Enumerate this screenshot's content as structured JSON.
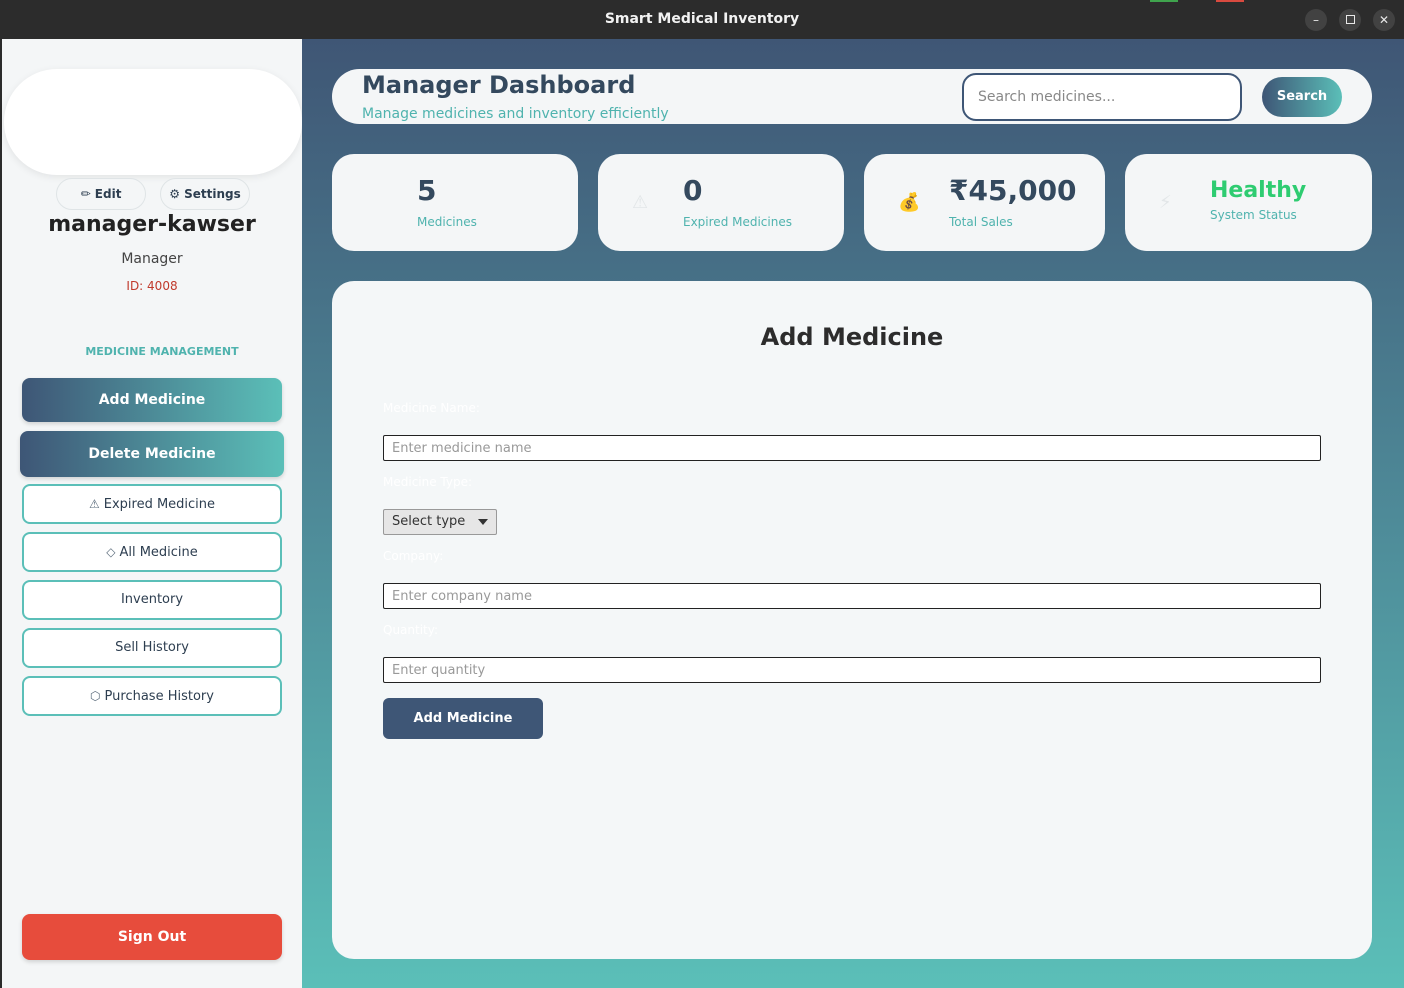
{
  "window": {
    "title": "Smart Medical Inventory",
    "controls": {
      "minimize": "–",
      "close": "✕"
    }
  },
  "sidebar": {
    "edit_label": "✏ Edit",
    "settings_label": "⚙ Settings",
    "username": "manager-kawser",
    "role": "Manager",
    "user_id": "ID: 4008",
    "section_title": "MEDICINE MANAGEMENT",
    "nav": {
      "add_medicine": "Add Medicine",
      "delete_medicine": "Delete Medicine",
      "expired": {
        "icon": "⚠",
        "label": "Expired Medicine"
      },
      "all": {
        "icon": "◇",
        "label": "All Medicine"
      },
      "inventory": {
        "label": "Inventory"
      },
      "sell_history": {
        "label": "Sell History"
      },
      "purchase_history": {
        "icon": "⬡",
        "label": "Purchase History"
      }
    },
    "sign_out": "Sign Out"
  },
  "header": {
    "title": "Manager Dashboard",
    "subtitle": "Manage medicines and inventory efficiently",
    "search_placeholder": "Search medicines...",
    "search_button": "Search"
  },
  "stats": {
    "medicines": {
      "icon": "",
      "value": "5",
      "label": "Medicines"
    },
    "expired": {
      "icon": "⚠",
      "value": "0",
      "label": "Expired Medicines"
    },
    "sales": {
      "icon": "💰",
      "value": "₹45,000",
      "label": "Total Sales"
    },
    "status": {
      "icon": "⚡",
      "value": "Healthy",
      "label": "System Status"
    }
  },
  "form": {
    "title": "Add Medicine",
    "name_label": "Medicine Name:",
    "name_placeholder": "Enter medicine name",
    "type_label": "Medicine Type:",
    "type_value": "Select type",
    "company_label": "Company:",
    "company_placeholder": "Enter company name",
    "quantity_label": "Quantity:",
    "quantity_placeholder": "Enter quantity",
    "submit": "Add Medicine"
  },
  "colors": {
    "accent_teal": "#5bbfb8",
    "accent_navy": "#3e5676",
    "danger": "#e74c3c",
    "healthy": "#2ecc71"
  }
}
